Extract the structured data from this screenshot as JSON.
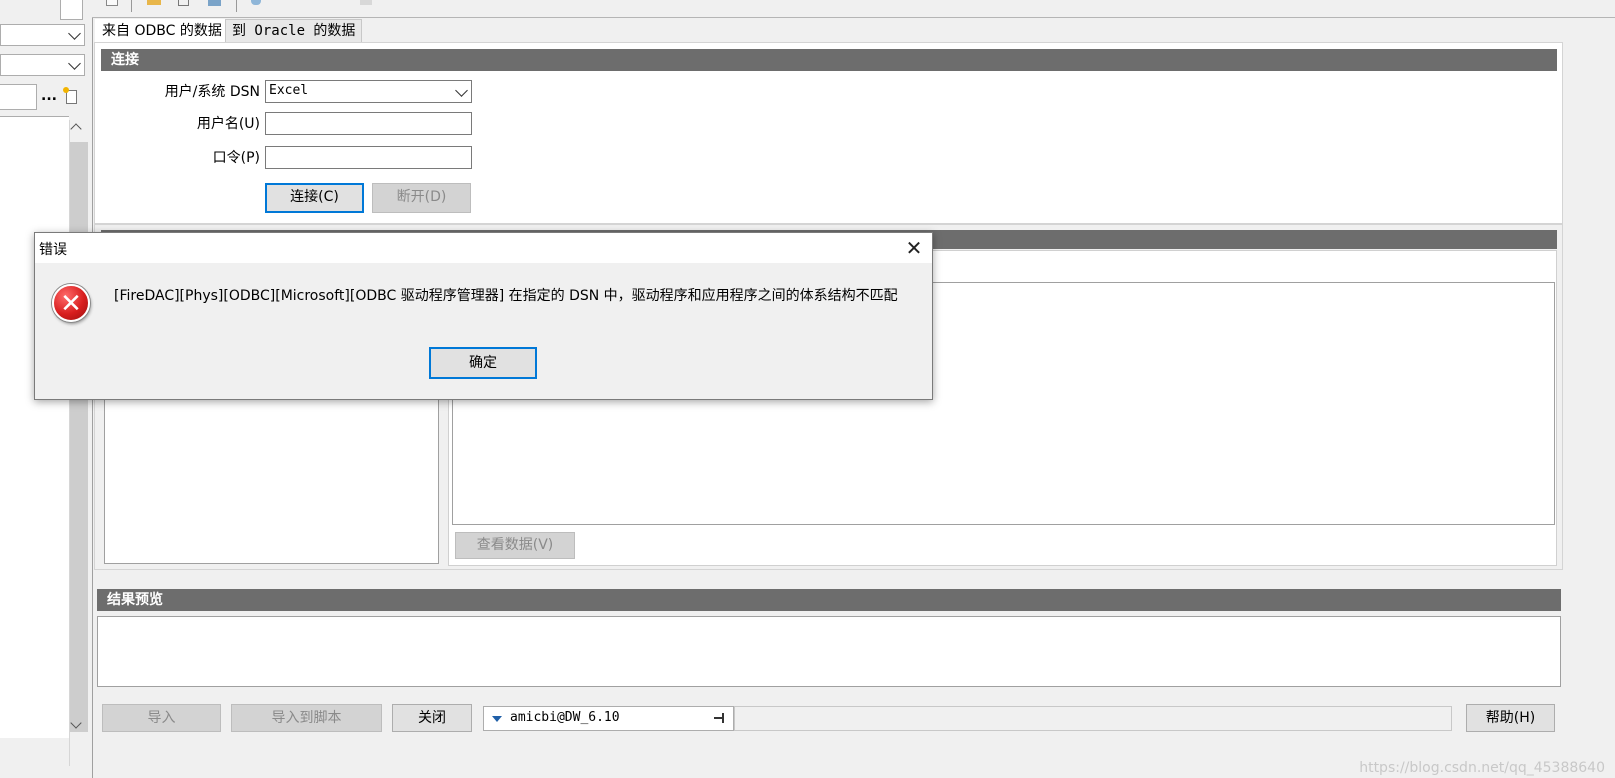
{
  "tabs": [
    {
      "label": "来自 ODBC 的数据"
    },
    {
      "label": "到 Oracle 的数据"
    }
  ],
  "connect_section": {
    "header": "连接",
    "dsn_label": "用户/系统 DSN",
    "dsn_value": "Excel",
    "username_label": "用户名(U)",
    "username_value": "",
    "password_label": "口令(P)",
    "password_value": "",
    "connect_button": "连接(C)",
    "disconnect_button": "断开(D)"
  },
  "data_section": {
    "view_data_button": "查看数据(V)"
  },
  "preview_section": {
    "header": "结果预览"
  },
  "left_panel": {
    "browse_button": "..."
  },
  "bottom_bar": {
    "import_button": "导入",
    "import_script_button": "导入到脚本",
    "close_button": "关闭",
    "connection_value": "amicbi@DW_6.10",
    "help_button": "帮助(H)"
  },
  "dialog": {
    "title": "错误",
    "close_glyph": "✕",
    "error_glyph": "✕",
    "message": "[FireDAC][Phys][ODBC][Microsoft][ODBC 驱动程序管理器] 在指定的 DSN 中，驱动程序和应用程序之间的体系结构不匹配",
    "ok_button": "确定"
  },
  "watermark": "https://blog.csdn.net/qq_45388640",
  "colors": {
    "section_header": "#6d6d6d",
    "focus_border": "#0078d7",
    "error_red": "#d81e1e"
  }
}
